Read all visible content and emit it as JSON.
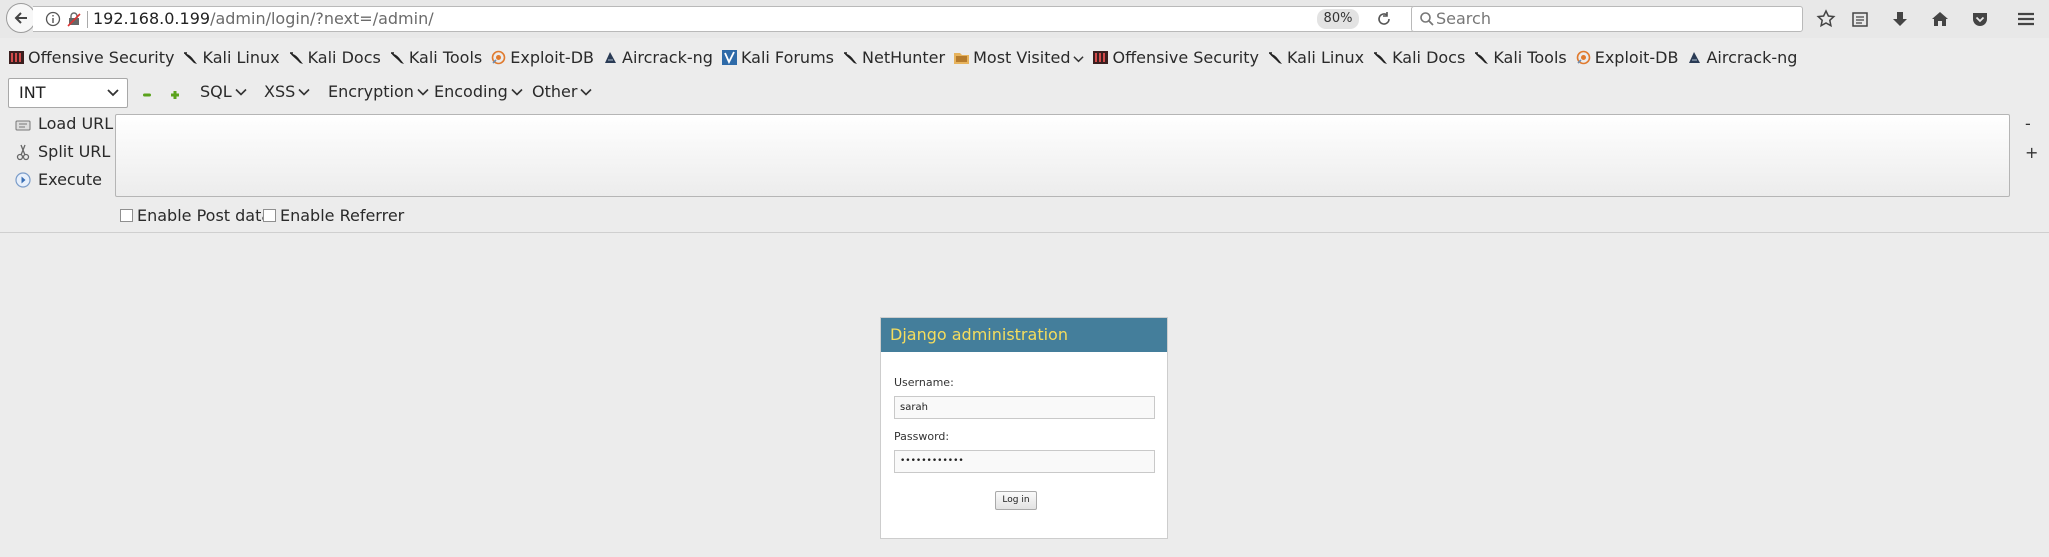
{
  "browser": {
    "url_host": "192.168.0.199",
    "url_path": "/admin/login/?next=/admin/",
    "zoom": "80%",
    "search_placeholder": "Search"
  },
  "bookmarks": [
    {
      "label": "Offensive Security",
      "icon": "offsec-icon"
    },
    {
      "label": "Kali Linux",
      "icon": "kali-dragon-icon"
    },
    {
      "label": "Kali Docs",
      "icon": "kali-dragon-icon"
    },
    {
      "label": "Kali Tools",
      "icon": "kali-dragon-icon"
    },
    {
      "label": "Exploit-DB",
      "icon": "exploitdb-icon"
    },
    {
      "label": "Aircrack-ng",
      "icon": "aircrack-icon"
    },
    {
      "label": "Kali Forums",
      "icon": "kali-forums-icon"
    },
    {
      "label": "NetHunter",
      "icon": "kali-dragon-icon"
    },
    {
      "label": "Most Visited",
      "icon": "folder-icon"
    },
    {
      "label": "Offensive Security",
      "icon": "offsec-icon"
    },
    {
      "label": "Kali Linux",
      "icon": "kali-dragon-icon"
    },
    {
      "label": "Kali Docs",
      "icon": "kali-dragon-icon"
    },
    {
      "label": "Kali Tools",
      "icon": "kali-dragon-icon"
    },
    {
      "label": "Exploit-DB",
      "icon": "exploitdb-icon"
    },
    {
      "label": "Aircrack-ng",
      "icon": "aircrack-icon"
    }
  ],
  "hackbar": {
    "select_value": "INT",
    "menus": [
      "SQL",
      "XSS",
      "Encryption",
      "Encoding",
      "Other"
    ],
    "load_url": "Load URL",
    "split_url": "Split URL",
    "execute": "Execute",
    "minus": "-",
    "plus": "+",
    "post_data": "Enable Post data",
    "referrer": "Enable Referrer"
  },
  "login": {
    "title": "Django administration",
    "username_label": "Username:",
    "username_value": "sarah",
    "password_label": "Password:",
    "password_value": "••••••••••••",
    "submit": "Log in"
  },
  "colors": {
    "django_header": "#447e9b",
    "django_title": "#f5dd5d"
  }
}
